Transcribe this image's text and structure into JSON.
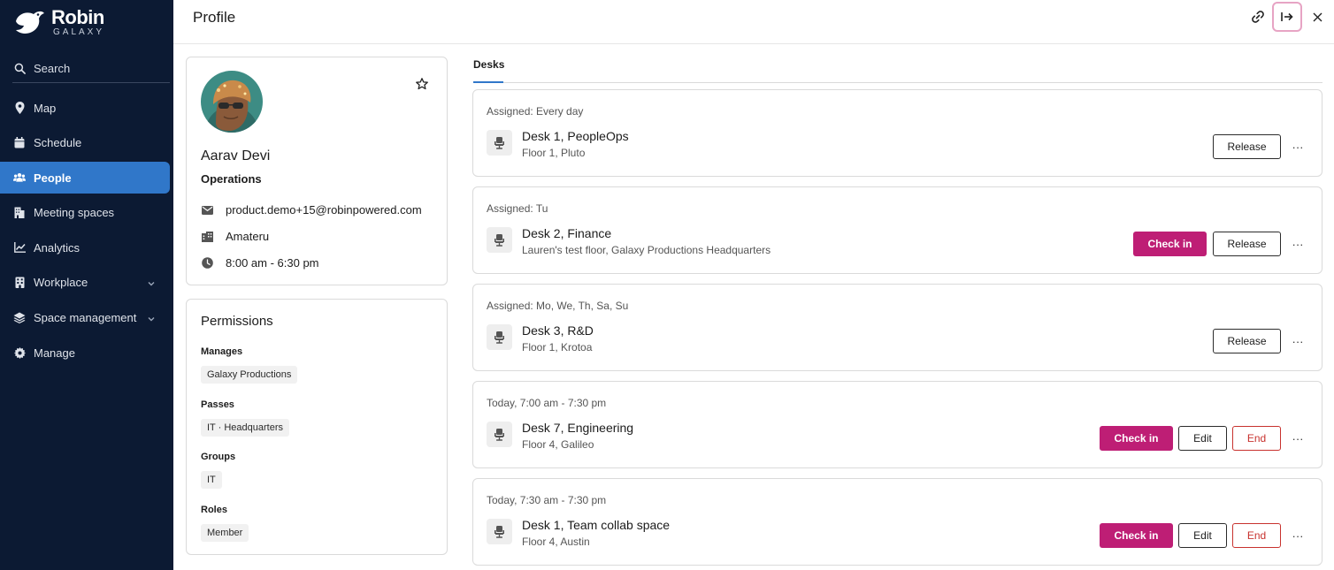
{
  "sidebar": {
    "logo": {
      "name": "Robin",
      "sub": "GALAXY"
    },
    "search_label": "Search",
    "items": [
      {
        "label": "Map",
        "icon": "map-pin-icon"
      },
      {
        "label": "Schedule",
        "icon": "calendar-icon"
      },
      {
        "label": "People",
        "icon": "people-icon",
        "active": true
      },
      {
        "label": "Meeting spaces",
        "icon": "building-icon"
      },
      {
        "label": "Analytics",
        "icon": "analytics-icon"
      },
      {
        "label": "Workplace",
        "icon": "workplace-icon",
        "chevron": true
      },
      {
        "label": "Space management",
        "icon": "layers-icon",
        "chevron": true
      },
      {
        "label": "Manage",
        "icon": "gear-icon"
      }
    ]
  },
  "header": {
    "title": "Profile"
  },
  "profile": {
    "name": "Aarav Devi",
    "department": "Operations",
    "email": "product.demo+15@robinpowered.com",
    "building": "Amateru",
    "hours": "8:00 am - 6:30 pm"
  },
  "permissions": {
    "title": "Permissions",
    "sections": [
      {
        "label": "Manages",
        "value": "Galaxy Productions"
      },
      {
        "label": "Passes",
        "value": "IT · Headquarters"
      },
      {
        "label": "Groups",
        "value": "IT"
      },
      {
        "label": "Roles",
        "value": "Member"
      }
    ]
  },
  "tabs": {
    "desks": "Desks"
  },
  "desks": [
    {
      "when": "Assigned: Every day",
      "name": "Desk 1, PeopleOps",
      "location": "Floor 1, Pluto",
      "release": "Release",
      "more": "···"
    },
    {
      "when": "Assigned: Tu",
      "name": "Desk 2, Finance",
      "location": "Lauren's test floor, Galaxy Productions Headquarters",
      "checkin": "Check in",
      "release": "Release",
      "more": "···"
    },
    {
      "when": "Assigned: Mo, We, Th, Sa, Su",
      "name": "Desk 3, R&D",
      "location": "Floor 1, Krotoa",
      "release": "Release",
      "more": "···"
    },
    {
      "when": "Today, 7:00 am - 7:30 pm",
      "name": "Desk 7, Engineering",
      "location": "Floor 4, Galileo",
      "checkin": "Check in",
      "edit": "Edit",
      "end": "End",
      "more": "···"
    },
    {
      "when": "Today, 7:30 am - 7:30 pm",
      "name": "Desk 1, Team collab space",
      "location": "Floor 4, Austin",
      "checkin": "Check in",
      "edit": "Edit",
      "end": "End",
      "more": "···"
    }
  ],
  "colors": {
    "sidebar_bg": "#0c1a33",
    "active_nav": "#3077c9",
    "checkin": "#be1e75",
    "end": "#c8322e"
  }
}
